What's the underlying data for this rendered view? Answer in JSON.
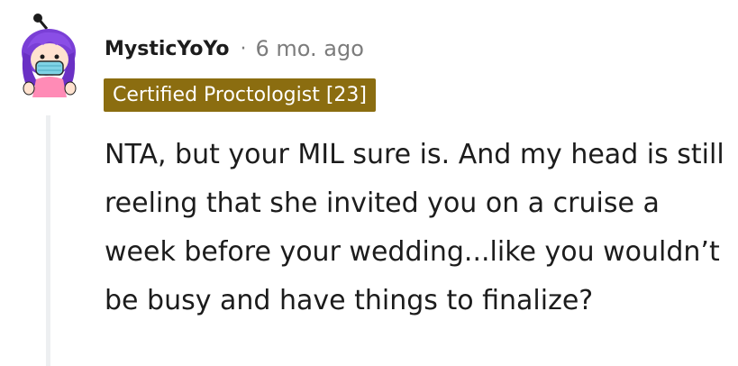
{
  "comment": {
    "username": "MysticYoYo",
    "separator": "·",
    "timestamp": "6 mo. ago",
    "flair": "Certified Proctologist [23]",
    "body": "NTA, but your MIL sure is. And my head is still reeling that she invited you on a cruise a week before your wedding...like you wouldn’t be busy and have things to finalize?",
    "avatar_icon": "snoo-avatar-icon"
  },
  "colors": {
    "flair_bg": "#8b6d10",
    "flair_text": "#ffffff",
    "username": "#1c1c1c",
    "meta": "#7c7c7c",
    "thread_line": "#edeff1"
  }
}
